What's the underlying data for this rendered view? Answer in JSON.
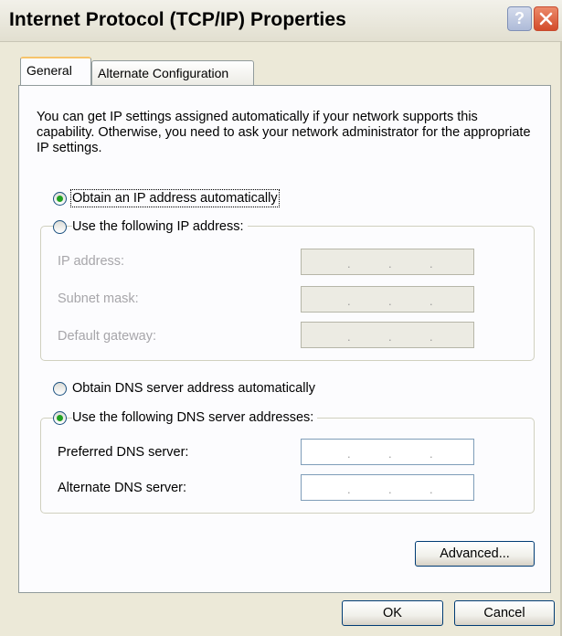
{
  "window": {
    "title": "Internet Protocol (TCP/IP) Properties",
    "help_label": "?",
    "close_label": "×"
  },
  "tabs": [
    {
      "label": "General",
      "active": true
    },
    {
      "label": "Alternate Configuration",
      "active": false
    }
  ],
  "info_text": "You can get IP settings assigned automatically if your network supports this capability. Otherwise, you need to ask your network administrator for the appropriate IP settings.",
  "ip": {
    "auto_label": "Obtain an IP address automatically",
    "auto_selected": true,
    "manual_label": "Use the following IP address:",
    "manual_selected": false,
    "fields": [
      {
        "label": "IP address:",
        "value": ". . ."
      },
      {
        "label": "Subnet mask:",
        "value": ". . ."
      },
      {
        "label": "Default gateway:",
        "value": ". . ."
      }
    ]
  },
  "dns": {
    "auto_label": "Obtain DNS server address automatically",
    "auto_selected": false,
    "manual_label": "Use the following DNS server addresses:",
    "manual_selected": true,
    "fields": [
      {
        "label": "Preferred DNS server:",
        "value": ". . ."
      },
      {
        "label": "Alternate DNS server:",
        "value": ". . ."
      }
    ]
  },
  "buttons": {
    "advanced": "Advanced...",
    "ok": "OK",
    "cancel": "Cancel"
  },
  "colors": {
    "dialog_bg": "#ece9d8",
    "panel_bg": "#fcfcfe",
    "radio_dot": "#21a121",
    "close_red": "#d34b2a",
    "help_blue": "#aebbd8"
  }
}
